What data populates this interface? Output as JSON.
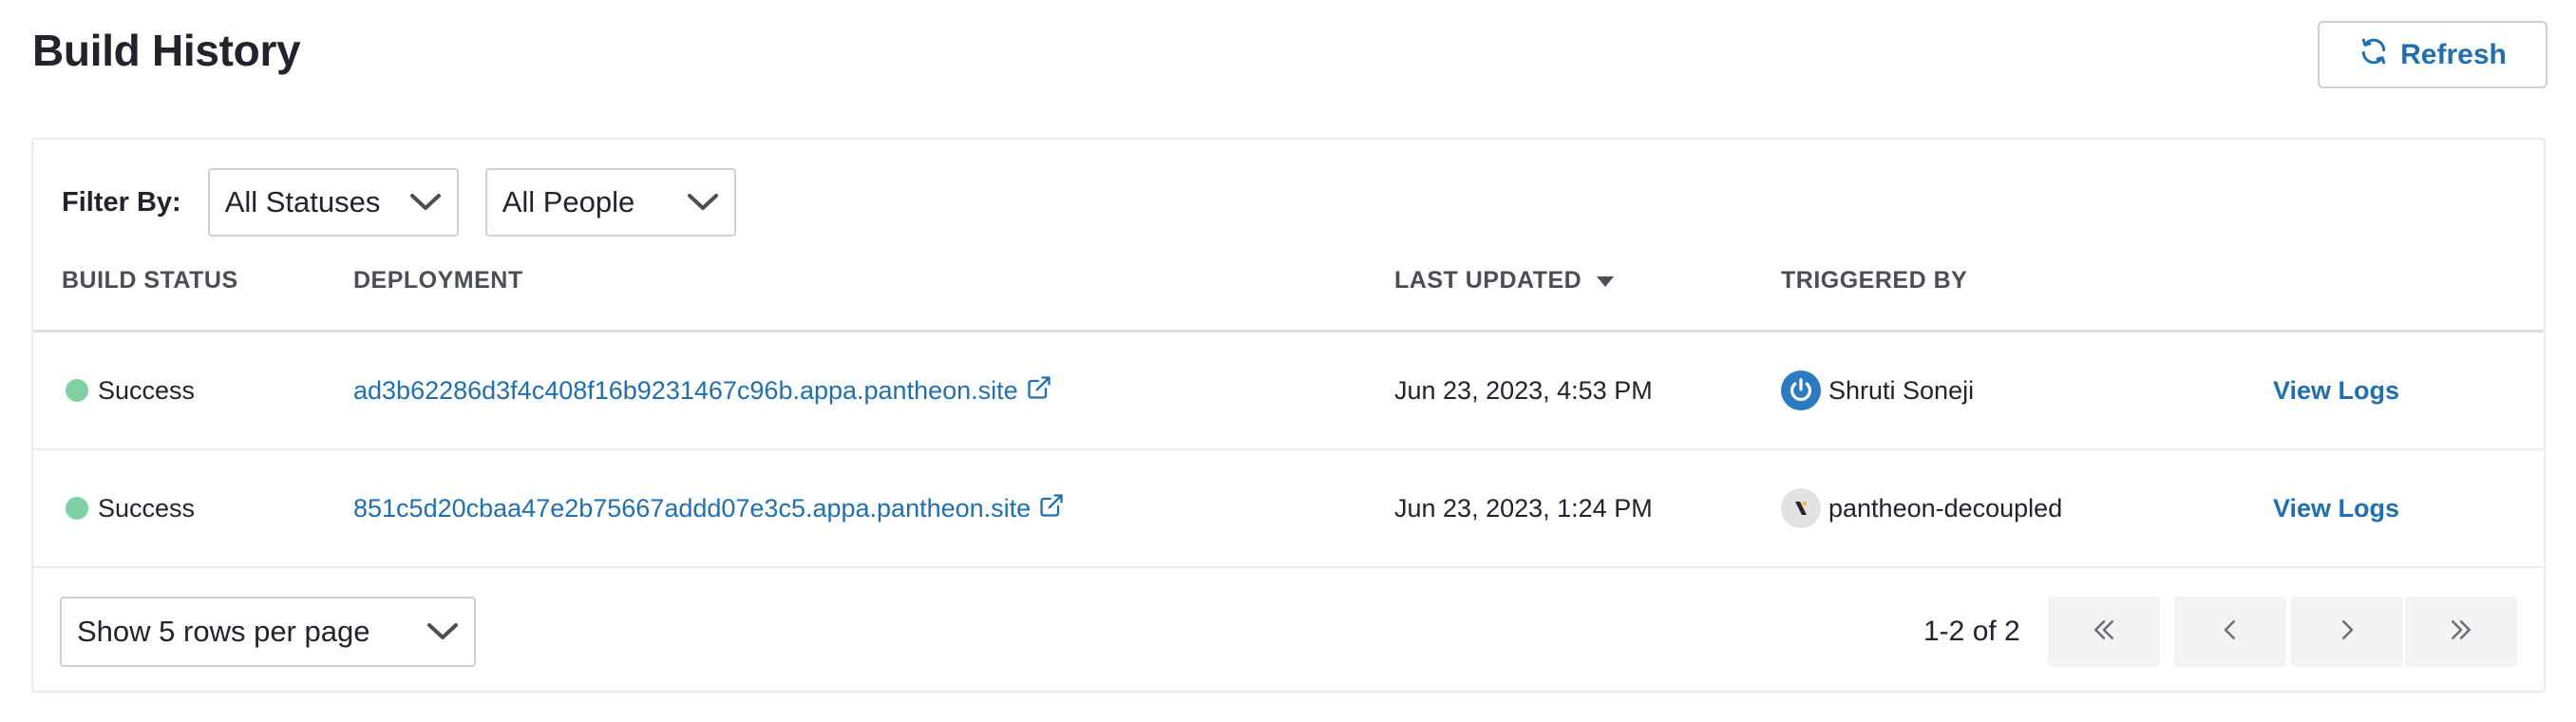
{
  "header": {
    "title": "Build History",
    "refresh_label": "Refresh"
  },
  "filters": {
    "label": "Filter By:",
    "status_value": "All Statuses",
    "people_value": "All People"
  },
  "table": {
    "columns": [
      "BUILD STATUS",
      "DEPLOYMENT",
      "LAST UPDATED",
      "TRIGGERED BY"
    ],
    "sort_column": "LAST UPDATED",
    "sort_direction": "descending",
    "rows": [
      {
        "status": "Success",
        "deployment": "ad3b62286d3f4c408f16b9231467c96b.appa.pantheon.site",
        "last_updated": "Jun 23, 2023, 4:53 PM",
        "triggered_by": "Shruti Soneji",
        "avatar_icon": "power-icon",
        "action": "View Logs"
      },
      {
        "status": "Success",
        "deployment": "851c5d20cbaa47e2b75667addd07e3c5.appa.pantheon.site",
        "last_updated": "Jun 23, 2023, 1:24 PM",
        "triggered_by": "pantheon-decoupled",
        "avatar_icon": "pantheon-logo-icon",
        "action": "View Logs"
      }
    ]
  },
  "pagination": {
    "rows_per_page": "Show 5 rows per page",
    "range": "1-2 of 2"
  },
  "colors": {
    "accent": "#1f6fb1",
    "success": "#7fd1a4",
    "text": "#23232d",
    "border": "#cfd0d4"
  }
}
